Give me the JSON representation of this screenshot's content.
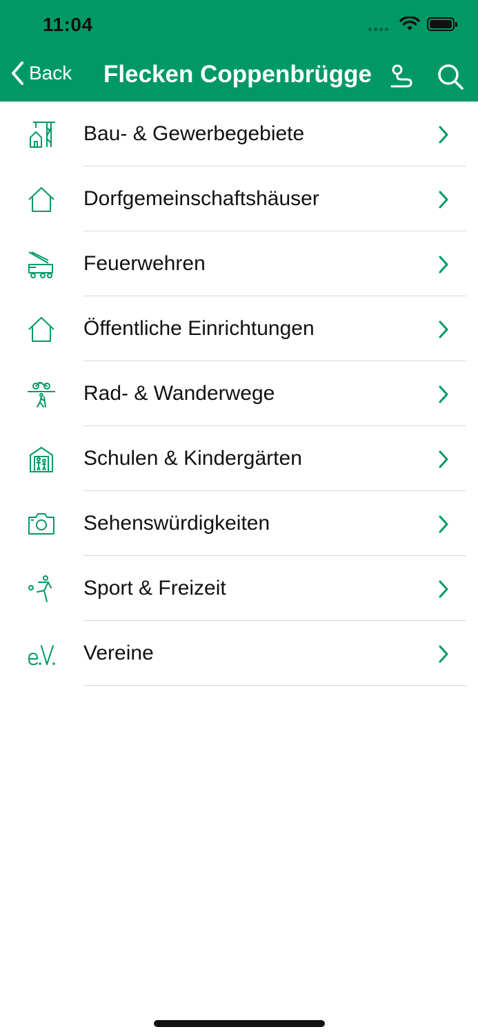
{
  "status_bar": {
    "time": "11:04"
  },
  "nav": {
    "back_label": "Back",
    "title": "Flecken Coppenbrügge",
    "route_icon": "route-icon",
    "search_icon": "search-icon"
  },
  "colors": {
    "accent": "#009966",
    "text": "#111111",
    "separator": "#d8d8d8"
  },
  "items": [
    {
      "label": "Bau- & Gewerbegebiete",
      "icon": "crane-house-icon"
    },
    {
      "label": "Dorfgemeinschaftshäuser",
      "icon": "house-icon"
    },
    {
      "label": "Feuerwehren",
      "icon": "fire-truck-icon"
    },
    {
      "label": "Öffentliche Einrichtungen",
      "icon": "house-icon"
    },
    {
      "label": "Rad- & Wanderwege",
      "icon": "bike-hiker-icon"
    },
    {
      "label": "Schulen & Kindergärten",
      "icon": "school-icon"
    },
    {
      "label": "Sehenswürdigkeiten",
      "icon": "camera-icon"
    },
    {
      "label": "Sport & Freizeit",
      "icon": "sport-icon"
    },
    {
      "label": "Vereine",
      "icon": "ev-icon"
    }
  ]
}
